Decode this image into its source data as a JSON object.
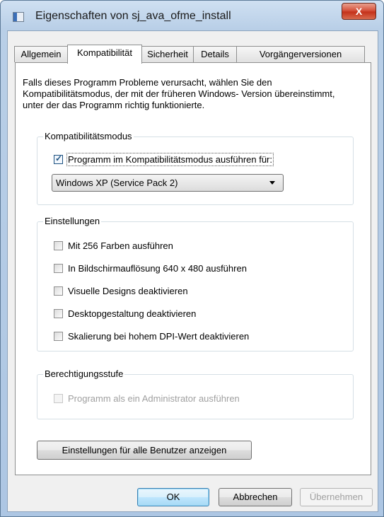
{
  "window": {
    "title": "Eigenschaften von sj_ava_ofme_install",
    "close_glyph": "X"
  },
  "tabs": [
    {
      "label": "Allgemein",
      "active": false
    },
    {
      "label": "Kompatibilität",
      "active": true
    },
    {
      "label": "Sicherheit",
      "active": false
    },
    {
      "label": "Details",
      "active": false
    },
    {
      "label": "Vorgängerversionen",
      "active": false
    }
  ],
  "description": "Falls dieses Programm Probleme verursacht, wählen Sie den Kompatibilitätsmodus, der mit der früheren Windows- Version übereinstimmt, unter der das Programm richtig funktionierte.",
  "compat_group": {
    "label": "Kompatibilitätsmodus",
    "checkbox_label": "Programm im Kompatibilitätsmodus ausführen für:",
    "checkbox_checked": true,
    "select_value": "Windows XP (Service Pack 2)"
  },
  "settings_group": {
    "label": "Einstellungen",
    "options": [
      {
        "label": "Mit 256 Farben ausführen",
        "checked": false
      },
      {
        "label": "In Bildschirmauflösung 640 x 480 ausführen",
        "checked": false
      },
      {
        "label": "Visuelle Designs deaktivieren",
        "checked": false
      },
      {
        "label": "Desktopgestaltung deaktivieren",
        "checked": false
      },
      {
        "label": "Skalierung bei hohem DPI-Wert deaktivieren",
        "checked": false
      }
    ]
  },
  "privilege_group": {
    "label": "Berechtigungsstufe",
    "checkbox_label": "Programm als ein Administrator ausführen",
    "enabled": false
  },
  "all_users_button": "Einstellungen für alle Benutzer anzeigen",
  "footer": {
    "ok": "OK",
    "cancel": "Abbrechen",
    "apply": "Übernehmen"
  }
}
